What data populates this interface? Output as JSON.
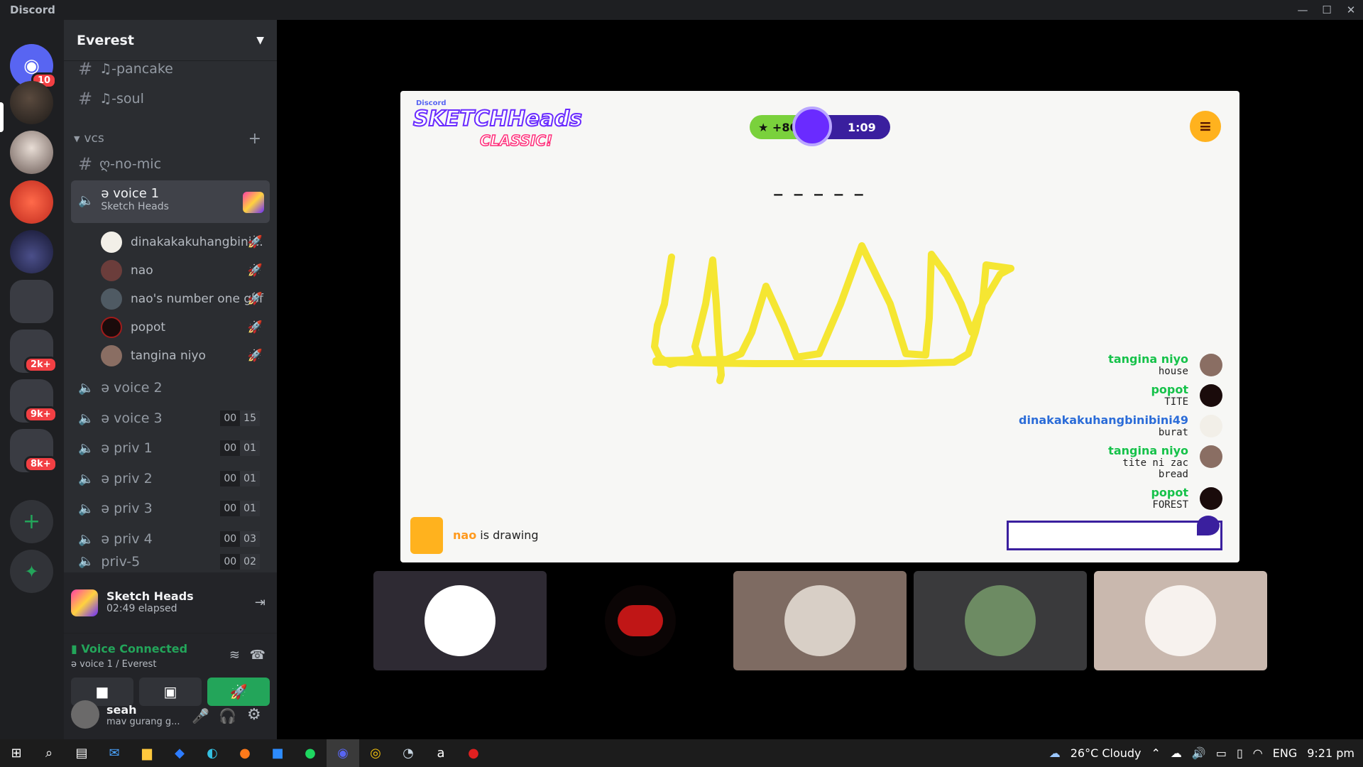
{
  "window": {
    "title": "Discord",
    "controls": [
      "—",
      "☐",
      "✕"
    ]
  },
  "rail": {
    "home_badge": "10",
    "badges": [
      "2k+",
      "9k+",
      "8k+"
    ],
    "add_server": "+",
    "explore": "explore-icon"
  },
  "guild": {
    "name": "Everest"
  },
  "channels": {
    "text": [
      "♫-pancake",
      "♫-soul"
    ],
    "category": "vcs",
    "nomic": "ღ-no-mic",
    "active_voice": {
      "name": "ə voice 1",
      "activity": "Sketch Heads"
    },
    "members": [
      "dinakakakuhangbini...",
      "nao",
      "nao's number one gbf",
      "popot",
      "tangina niyo"
    ],
    "voice": [
      {
        "name": "ə voice 2",
        "c1": "",
        "c2": ""
      },
      {
        "name": "ə voice 3",
        "c1": "00",
        "c2": "15"
      },
      {
        "name": "ə priv 1",
        "c1": "00",
        "c2": "01"
      },
      {
        "name": "ə priv 2",
        "c1": "00",
        "c2": "01"
      },
      {
        "name": "ə priv 3",
        "c1": "00",
        "c2": "01"
      },
      {
        "name": "ə priv 4",
        "c1": "00",
        "c2": "03"
      },
      {
        "name": "priv-5",
        "c1": "00",
        "c2": "02"
      }
    ]
  },
  "activity": {
    "name": "Sketch Heads",
    "elapsed": "02:49 elapsed"
  },
  "voice": {
    "status": "Voice Connected",
    "where": "ə voice 1 / Everest"
  },
  "user": {
    "name": "seah",
    "status": "mav gurang g..."
  },
  "game": {
    "brand": "Discord",
    "logo_top": "SKETCHHeads",
    "logo_bottom": "CLASSIC!",
    "score": "★ +80",
    "timer": "1:09",
    "word_hint": "_ _ _ _ _",
    "drawer": "nao",
    "drawer_suffix": "is drawing",
    "chat": [
      {
        "name": "tangina niyo",
        "msg": "house",
        "color": "#16c24a"
      },
      {
        "name": "popot",
        "msg": "TITE",
        "color": "#16c24a"
      },
      {
        "name": "dinakakakuhangbinibini49",
        "msg": "burat",
        "color": "#2b6cd8"
      },
      {
        "name": "tangina niyo",
        "msg": "tite ni zac\nbread",
        "color": "#16c24a"
      },
      {
        "name": "popot",
        "msg": "FOREST",
        "color": "#16c24a"
      }
    ]
  },
  "taskbar": {
    "weather": "26°C Cloudy",
    "lang": "ENG",
    "time": "9:21 pm"
  },
  "colors": {
    "accent": "#5865f2",
    "green": "#23a55a",
    "red": "#f23f43",
    "stroke": "#f5e632"
  }
}
